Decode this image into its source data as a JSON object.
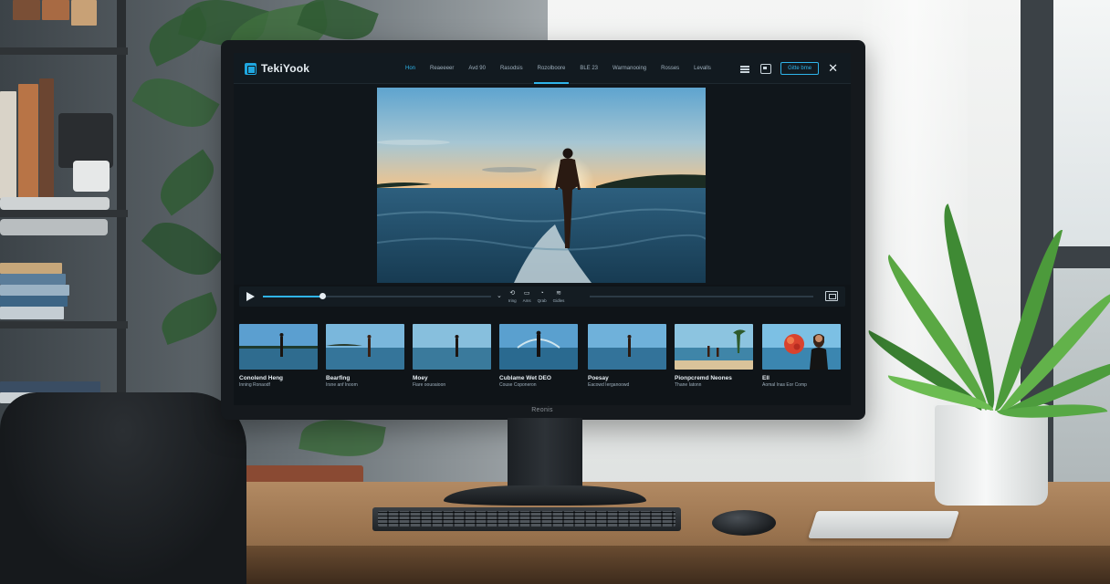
{
  "app": {
    "logo_text": "TekiYook",
    "accent_color": "#2fb4ea"
  },
  "nav": {
    "items": [
      {
        "label": "Hon",
        "state": "active"
      },
      {
        "label": "Reaeeeer",
        "state": "normal"
      },
      {
        "label": "Avd 90",
        "state": "normal"
      },
      {
        "label": "Rasodsis",
        "state": "normal"
      },
      {
        "label": "Rozolboore",
        "state": "underlined"
      },
      {
        "label": "BLE 23",
        "state": "normal"
      },
      {
        "label": "Warmanooing",
        "state": "normal"
      },
      {
        "label": "Rosses",
        "state": "normal"
      },
      {
        "label": "Levalls",
        "state": "normal"
      }
    ]
  },
  "top_actions": {
    "list_icon": "list-icon",
    "save_icon": "save-icon",
    "primary_button_label": "Gitte bme",
    "close_icon": "close-icon"
  },
  "player": {
    "progress": 0.26,
    "controls": [
      {
        "icon": "chevron-down-icon",
        "glyph": "⌄",
        "label": ""
      },
      {
        "icon": "rewind-icon",
        "glyph": "⟲",
        "label": "Iring"
      },
      {
        "icon": "cc-icon",
        "glyph": "▭",
        "label": "Ams"
      },
      {
        "icon": "speed-icon",
        "glyph": "◔",
        "label": "Qrab"
      },
      {
        "icon": "quality-icon",
        "glyph": "≋",
        "label": "Gidles"
      }
    ],
    "fullscreen_icon": "fullscreen-icon"
  },
  "thumbnails": [
    {
      "title": "Conolend Heng",
      "subtitle": "Inning Ronaodf"
    },
    {
      "title": "Bearfing",
      "subtitle": "Irsne anf Inoom"
    },
    {
      "title": "Moey",
      "subtitle": "Fiare oouoaioon"
    },
    {
      "title": "Cublame Wet DEO",
      "subtitle": "Couse Coponeron"
    },
    {
      "title": "Poesay",
      "subtitle": "Eacowd Ierganoowd"
    },
    {
      "title": "Pionpcremd Neones",
      "subtitle": "Thane Iatonn"
    },
    {
      "title": "EII",
      "subtitle": "Aomal Inas Eor Comp"
    }
  ],
  "monitor_brand": "Reonis"
}
